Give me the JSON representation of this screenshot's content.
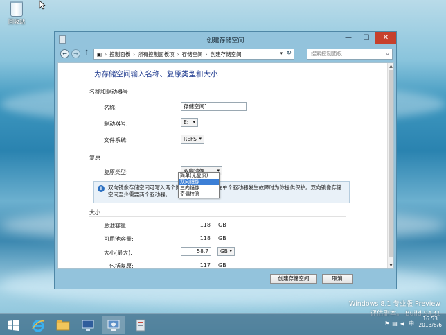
{
  "desktop": {
    "recycle_bin_label": "回收站"
  },
  "window": {
    "title": "创建存储空间",
    "controls": {
      "minimize": "—",
      "maximize": "☐",
      "close": "✕"
    },
    "breadcrumb": [
      "控制面板",
      "所有控制面板项",
      "存储空间",
      "创建存储空间"
    ],
    "search_placeholder": "搜索控制面板"
  },
  "form": {
    "heading": "为存储空间输入名称、复原类型和大小",
    "name_section": {
      "title": "名称和驱动器号",
      "name_label": "名称:",
      "name_value": "存储空间1",
      "drive_letter_label": "驱动器号:",
      "drive_letter_value": "E:",
      "filesystem_label": "文件系统:",
      "filesystem_value": "REFS"
    },
    "resiliency_section": {
      "title": "复原",
      "type_label": "复原类型:",
      "type_value": "双向镜像",
      "options": [
        "简单(无复原)",
        "双向镜像",
        "三向镜像",
        "奇偶校验"
      ],
      "highlighted_index": 1,
      "info_text": "双向镜像存储空间可写入两个数据副本，有助于在单个驱动器发生故障时为你提供保护。双向镜像存储空间至少需要两个驱动器。"
    },
    "size_section": {
      "title": "大小",
      "total_label": "总池容量:",
      "total_value": "118",
      "total_unit": "GB",
      "available_label": "可用池容量:",
      "available_value": "118",
      "available_unit": "GB",
      "size_label": "大小(最大):",
      "size_value": "58.7",
      "size_unit": "GB",
      "including_label": "包括复原:",
      "including_value": "117",
      "including_unit": "GB"
    },
    "buttons": {
      "create": "创建存储空间",
      "cancel": "取消"
    }
  },
  "watermark": {
    "line1": "Windows 8.1 专业版 Preview",
    "line2": "评估副本。 Build 9431"
  },
  "taskbar": {
    "time": "16:53",
    "date": "2013/8/6",
    "lang": "中"
  }
}
